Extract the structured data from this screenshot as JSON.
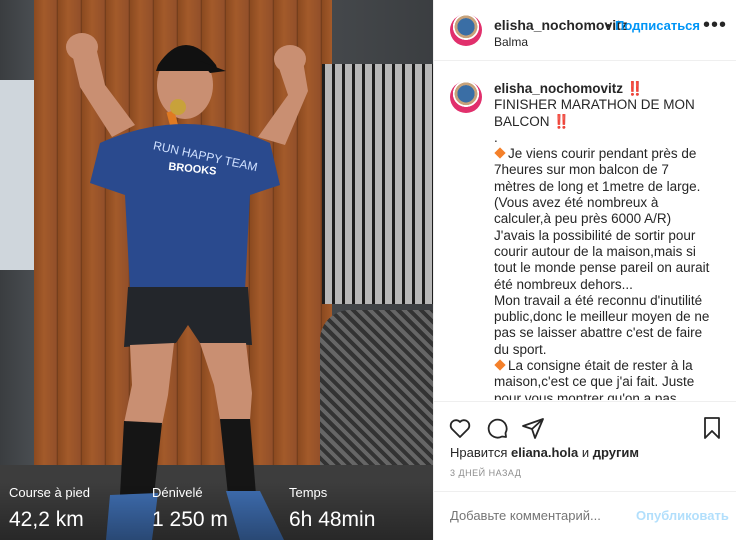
{
  "post": {
    "username": "elisha_nochomovitz",
    "location": "Balma",
    "follow_label": "Подписаться",
    "header_separator": "•",
    "photo_stats": [
      {
        "label": "Course à pied",
        "value": "42,2 km"
      },
      {
        "label": "Dénivelé",
        "value": "1 250 m"
      },
      {
        "label": "Temps",
        "value": "6h 48min"
      }
    ]
  },
  "caption": {
    "username": "elisha_nochomovitz",
    "lines": [
      "‼️ FINISHER MARATHON DE MON BALCON ‼️",
      ".",
      "Je viens courir pendant près de 7heures sur mon balcon de 7 mètres de long et 1metre de large. (Vous avez été nombreux à calculer,à peu près 6000 A/R)",
      "J'avais la possibilité de sortir pour courir autour de la maison,mais si tout le monde pense pareil on aurait été nombreux dehors...",
      "Mon travail a été reconnu d'inutilité public,donc le meilleur moyen de ne pas se laisser abattre c'est de faire du sport.",
      "La consigne était de rester à la maison,c'est ce que j'ai fait. Juste pour vous montrer qu'on a pas d'excuses,et s'il vous plaît penser à toutes ces"
    ]
  },
  "likes": {
    "prefix": "Нравится",
    "user": "eliana.hola",
    "joiner": "и",
    "others": "другим"
  },
  "timestamp": "3 ДНЕЙ НАЗАД",
  "comment": {
    "placeholder": "Добавьте комментарий...",
    "publish_label": "Опубликовать"
  },
  "icons": {
    "heart": "heart-icon",
    "comment": "comment-icon",
    "share": "share-icon",
    "save": "bookmark-icon",
    "more": "more-options-icon"
  },
  "colors": {
    "accent": "#0095f6",
    "publish_disabled": "#b2dffc",
    "bullet": "#f4802a"
  }
}
